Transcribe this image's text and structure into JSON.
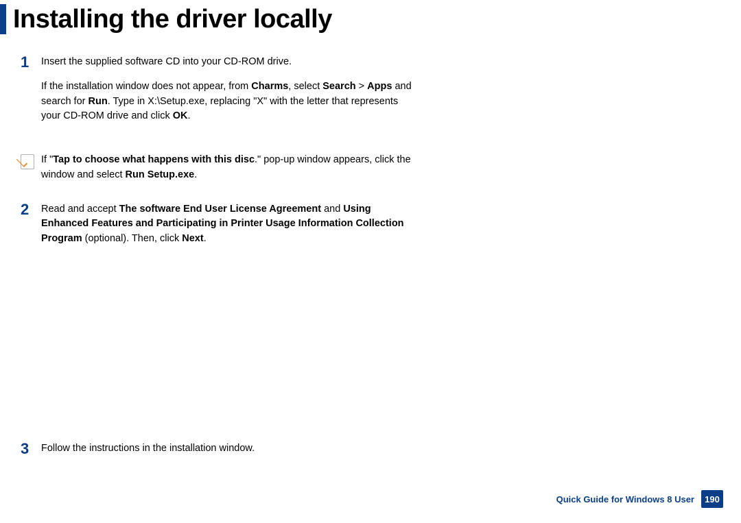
{
  "title": "Installing the driver locally",
  "steps": {
    "s1": {
      "num": "1",
      "p1": "Insert the supplied software CD into your CD-ROM drive.",
      "p2_a": "If the installation window does not appear, from ",
      "p2_b": "Charms",
      "p2_c": ", select ",
      "p2_d": "Search",
      "p2_e": " > ",
      "p2_f": "Apps",
      "p2_g": " and search for ",
      "p2_h": "Run",
      "p2_i": ". Type in X:\\Setup.exe, replacing \"X\" with the letter that represents your CD-ROM drive and click ",
      "p2_j": "OK",
      "p2_k": "."
    },
    "note1": {
      "a": "If \"",
      "b": "Tap to choose what happens with this disc",
      "c": ".\" pop-up window appears, click the window and select ",
      "d": "Run Setup.exe",
      "e": "."
    },
    "s2": {
      "num": "2",
      "a": "Read and accept ",
      "b": "The software End User License Agreement",
      "c": " and ",
      "d": "Using Enhanced Features and Participating in Printer Usage Information Collection Program",
      "e": " (optional). Then, click ",
      "f": "Next",
      "g": "."
    },
    "s3": {
      "num": "3",
      "a": "Follow the instructions in the installation window."
    }
  },
  "footer": {
    "label": "Quick Guide for Windows 8 User",
    "page": "190"
  }
}
